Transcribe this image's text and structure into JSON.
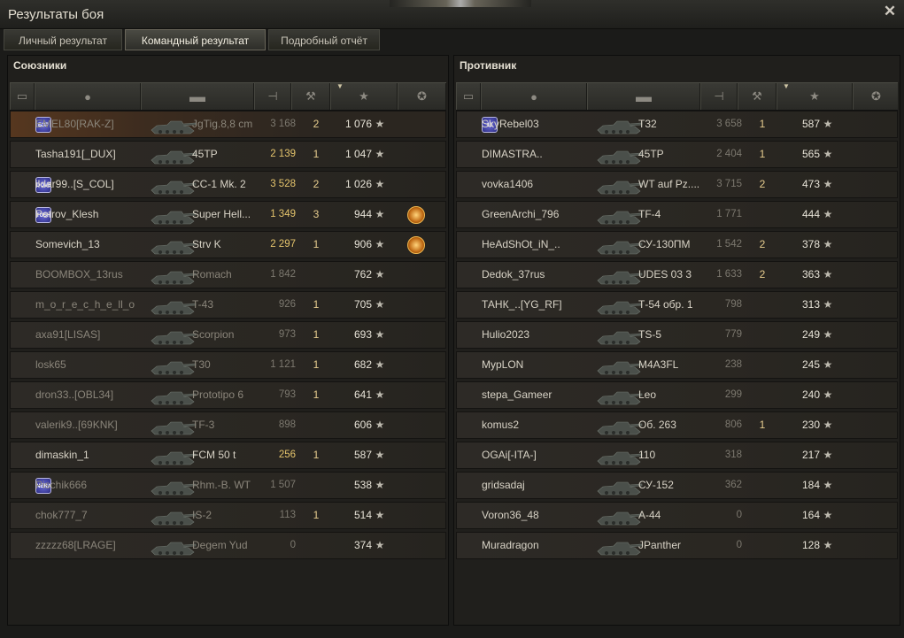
{
  "window": {
    "title": "Результаты боя",
    "close_icon": "close-icon"
  },
  "tabs": [
    {
      "label": "Личный результат",
      "active": false
    },
    {
      "label": "Командный результат",
      "active": true
    },
    {
      "label": "Подробный отчёт",
      "active": false
    }
  ],
  "columns": [
    "platoon-icon",
    "player-icon",
    "tank-icon",
    "damage-icon",
    "kills-icon",
    "xp-star-icon",
    "medal-icon"
  ],
  "allies": {
    "title": "Союзники",
    "rows": [
      {
        "name": "EMEL80[RAK-Z]",
        "clan": "БЗР",
        "tank": "JgTig.8,8 cm",
        "damage": "3 168",
        "dmg_hi": false,
        "kills": "2",
        "xp": "1 076",
        "medal": false,
        "dead": true,
        "me": true
      },
      {
        "name": "Tasha191[_DUX]",
        "clan": "",
        "tank": "45TP",
        "damage": "2 139",
        "dmg_hi": true,
        "kills": "1",
        "xp": "1 047",
        "medal": false,
        "dead": false,
        "me": false
      },
      {
        "name": "ildar99..[S_COL]",
        "clan": "DOVE",
        "tank": "CC-1 Mk. 2",
        "damage": "3 528",
        "dmg_hi": true,
        "kills": "2",
        "xp": "1 026",
        "medal": false,
        "dead": false,
        "me": false
      },
      {
        "name": "Petrov_Klesh",
        "clan": "TUSH",
        "tank": "Super Hell...",
        "damage": "1 349",
        "dmg_hi": true,
        "kills": "3",
        "xp": "944",
        "medal": true,
        "dead": false,
        "me": false
      },
      {
        "name": "Somevich_13",
        "clan": "",
        "tank": "Strv K",
        "damage": "2 297",
        "dmg_hi": true,
        "kills": "1",
        "xp": "906",
        "medal": true,
        "dead": false,
        "me": false
      },
      {
        "name": "BOOMBOX_13rus",
        "clan": "",
        "tank": "Romach",
        "damage": "1 842",
        "dmg_hi": false,
        "kills": "",
        "xp": "762",
        "medal": false,
        "dead": true,
        "me": false
      },
      {
        "name": "m_o_r_e_c_h_e_ll_o",
        "clan": "",
        "tank": "T-43",
        "damage": "926",
        "dmg_hi": false,
        "kills": "1",
        "xp": "705",
        "medal": false,
        "dead": true,
        "me": false
      },
      {
        "name": "axa91[LISAS]",
        "clan": "",
        "tank": "Scorpion",
        "damage": "973",
        "dmg_hi": false,
        "kills": "1",
        "xp": "693",
        "medal": false,
        "dead": true,
        "me": false
      },
      {
        "name": "losk65",
        "clan": "",
        "tank": "T30",
        "damage": "1 121",
        "dmg_hi": false,
        "kills": "1",
        "xp": "682",
        "medal": false,
        "dead": true,
        "me": false
      },
      {
        "name": "dron33..[OBL34]",
        "clan": "",
        "tank": "Prototipo 6",
        "damage": "793",
        "dmg_hi": false,
        "kills": "1",
        "xp": "641",
        "medal": false,
        "dead": true,
        "me": false
      },
      {
        "name": "valerik9..[69KNK]",
        "clan": "",
        "tank": "TF-3",
        "damage": "898",
        "dmg_hi": false,
        "kills": "",
        "xp": "606",
        "medal": false,
        "dead": true,
        "me": false
      },
      {
        "name": "dimaskin_1",
        "clan": "",
        "tank": "FCM 50 t",
        "damage": "256",
        "dmg_hi": true,
        "kills": "1",
        "xp": "587",
        "medal": false,
        "dead": false,
        "me": false
      },
      {
        "name": "Pischik666",
        "clan": "NERA",
        "tank": "Rhm.-B. WT",
        "damage": "1 507",
        "dmg_hi": false,
        "kills": "",
        "xp": "538",
        "medal": false,
        "dead": true,
        "me": false
      },
      {
        "name": "chok777_7",
        "clan": "",
        "tank": "IS-2",
        "damage": "113",
        "dmg_hi": false,
        "kills": "1",
        "xp": "514",
        "medal": false,
        "dead": true,
        "me": false
      },
      {
        "name": "zzzzz68[LRAGE]",
        "clan": "",
        "tank": "Degem Yud",
        "damage": "0",
        "dmg_hi": false,
        "kills": "",
        "xp": "374",
        "medal": false,
        "dead": true,
        "me": false
      }
    ]
  },
  "enemies": {
    "title": "Противник",
    "rows": [
      {
        "name": "SkyRebel03",
        "clan": "13",
        "tank": "T32",
        "damage": "3 658",
        "dmg_hi": false,
        "kills": "1",
        "xp": "587",
        "dead": false
      },
      {
        "name": "DIMASTRA..",
        "clan": "",
        "tank": "45TP",
        "damage": "2 404",
        "dmg_hi": false,
        "kills": "1",
        "xp": "565",
        "dead": false
      },
      {
        "name": "vovka1406",
        "clan": "",
        "tank": "WT auf Pz....",
        "damage": "3 715",
        "dmg_hi": false,
        "kills": "2",
        "xp": "473",
        "dead": false
      },
      {
        "name": "GreenArchi_796",
        "clan": "",
        "tank": "TF-4",
        "damage": "1 771",
        "dmg_hi": false,
        "kills": "",
        "xp": "444",
        "dead": false
      },
      {
        "name": "HeAdShOt_iN_..",
        "clan": "",
        "tank": "СУ-130ПМ",
        "damage": "1 542",
        "dmg_hi": false,
        "kills": "2",
        "xp": "378",
        "dead": false
      },
      {
        "name": "Dedok_37rus",
        "clan": "",
        "tank": "UDES 03 3",
        "damage": "1 633",
        "dmg_hi": false,
        "kills": "2",
        "xp": "363",
        "dead": false
      },
      {
        "name": "ТАНК_..[YG_RF]",
        "clan": "",
        "tank": "Т-54 обр. 1",
        "damage": "798",
        "dmg_hi": false,
        "kills": "",
        "xp": "313",
        "dead": false
      },
      {
        "name": "Hulio2023",
        "clan": "",
        "tank": "TS-5",
        "damage": "779",
        "dmg_hi": false,
        "kills": "",
        "xp": "249",
        "dead": false
      },
      {
        "name": "MypLON",
        "clan": "",
        "tank": "M4A3FL",
        "damage": "238",
        "dmg_hi": false,
        "kills": "",
        "xp": "245",
        "dead": false
      },
      {
        "name": "stepa_Gameer",
        "clan": "",
        "tank": "Leo",
        "damage": "299",
        "dmg_hi": false,
        "kills": "",
        "xp": "240",
        "dead": false
      },
      {
        "name": "komus2",
        "clan": "",
        "tank": "Об. 263",
        "damage": "806",
        "dmg_hi": false,
        "kills": "1",
        "xp": "230",
        "dead": false
      },
      {
        "name": "OGAi[-ITA-]",
        "clan": "",
        "tank": "110",
        "damage": "318",
        "dmg_hi": false,
        "kills": "",
        "xp": "217",
        "dead": false
      },
      {
        "name": "gridsadaj",
        "clan": "",
        "tank": "СУ-152",
        "damage": "362",
        "dmg_hi": false,
        "kills": "",
        "xp": "184",
        "dead": false
      },
      {
        "name": "Voron36_48",
        "clan": "",
        "tank": "A-44",
        "damage": "0",
        "dmg_hi": false,
        "kills": "",
        "xp": "164",
        "dead": false
      },
      {
        "name": "Muradragon",
        "clan": "",
        "tank": "JPanther",
        "damage": "0",
        "dmg_hi": false,
        "kills": "",
        "xp": "128",
        "dead": false
      }
    ]
  },
  "star_glyph": "★"
}
